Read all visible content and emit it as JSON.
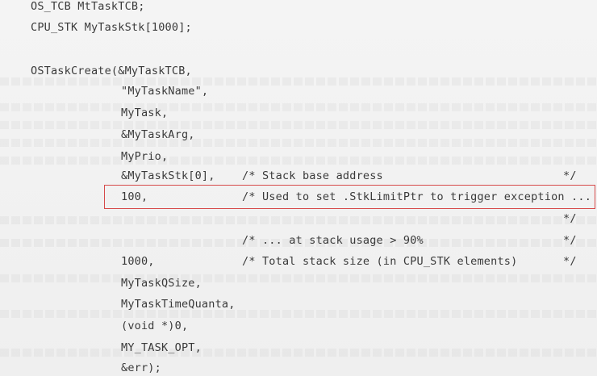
{
  "code": {
    "decl_tcb": "OS_TCB MtTaskTCB;",
    "decl_stk": "CPU_STK MyTaskStk[1000];",
    "call": "OSTaskCreate(&MyTaskTCB,",
    "args": {
      "name": "\"MyTaskName\",",
      "task": "MyTask,",
      "arg": "&MyTaskArg,",
      "prio": "MyPrio,",
      "stk_base": "&MyTaskStk[0],",
      "limit": "100,",
      "size": "1000,",
      "q_size": "MyTaskQSize,",
      "quanta": "MyTaskTimeQuanta,",
      "ext": "(void *)0,",
      "opt": "MY_TASK_OPT,",
      "err": "&err);"
    },
    "comments": {
      "stk_base": "/* Stack base address",
      "limit": "/* Used to set .StkLimitPtr to trigger exception ...",
      "usage": "/* ... at stack usage > 90%",
      "size": "/* Total stack size (in CPU_STK elements)",
      "close": "*/"
    }
  },
  "highlight_color": "#d64a4a"
}
